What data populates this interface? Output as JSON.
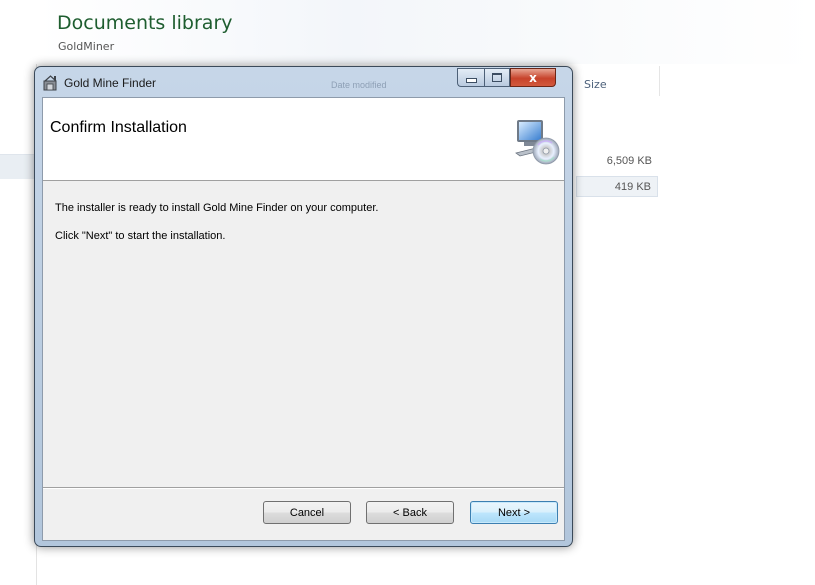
{
  "explorer": {
    "library_title": "Documents library",
    "library_subtitle": "GoldMiner",
    "size_column_header": "Size",
    "files": [
      {
        "size": "6,509 KB"
      },
      {
        "size": "419 KB"
      }
    ]
  },
  "dialog": {
    "window_title": "Gold Mine Finder",
    "faded_background_text": "Date modified",
    "controls": {
      "close_glyph": "x"
    },
    "banner_title": "Confirm Installation",
    "body_lines": [
      "The installer is ready to install Gold Mine Finder on your computer.",
      "Click \"Next\" to start the installation."
    ],
    "buttons": {
      "cancel": "Cancel",
      "back": "< Back",
      "next": "Next >"
    },
    "icons": {
      "app": "installer-app-icon",
      "banner": "computer-disc-icon"
    }
  }
}
